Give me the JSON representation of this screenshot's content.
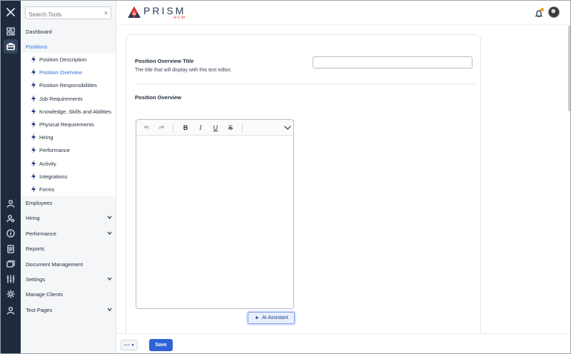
{
  "app": {
    "brand": "PRISM",
    "brand_sub": "HCM",
    "accent": "#2f6fde",
    "rail_bg": "#1e2a3e"
  },
  "rail": {
    "icons": [
      "close-icon",
      "dashboard-icon",
      "briefcase-icon",
      "person-icon",
      "person-search-icon",
      "info-icon",
      "report-icon",
      "folders-icon",
      "settings-sliders-icon",
      "gear-icon",
      "person-circle-icon"
    ]
  },
  "sidebar": {
    "search_placeholder": "Search Tools",
    "search_clear": "×",
    "dashboard": "Dashboard",
    "positions": "Positions",
    "sub_items": [
      "Position Description",
      "Position Overview",
      "Position Responsibilities",
      "Job Requirements",
      "Knowledge, Skills and Abilities",
      "Physical Requirements",
      "Hiring",
      "Performance",
      "Activity",
      "Integrations",
      "Forms"
    ],
    "employees": "Employees",
    "hiring": "Hiring",
    "performance": "Performance",
    "reports": "Reports",
    "document_management": "Document Management",
    "settings": "Settings",
    "manage_clients": "Manage Clients",
    "test_pages": "Test Pages"
  },
  "form": {
    "title_label": "Position Overview Title",
    "title_desc": "The title that will display with this text editor.",
    "title_value": "",
    "section_label": "Position Overview",
    "ai_label": "AI Assistant",
    "editor_tools": {
      "bold": "B",
      "italic": "I",
      "underline": "U",
      "strike": "S"
    }
  },
  "footer": {
    "more_label": "···",
    "more_caret": "▼",
    "save_label": "Save"
  }
}
